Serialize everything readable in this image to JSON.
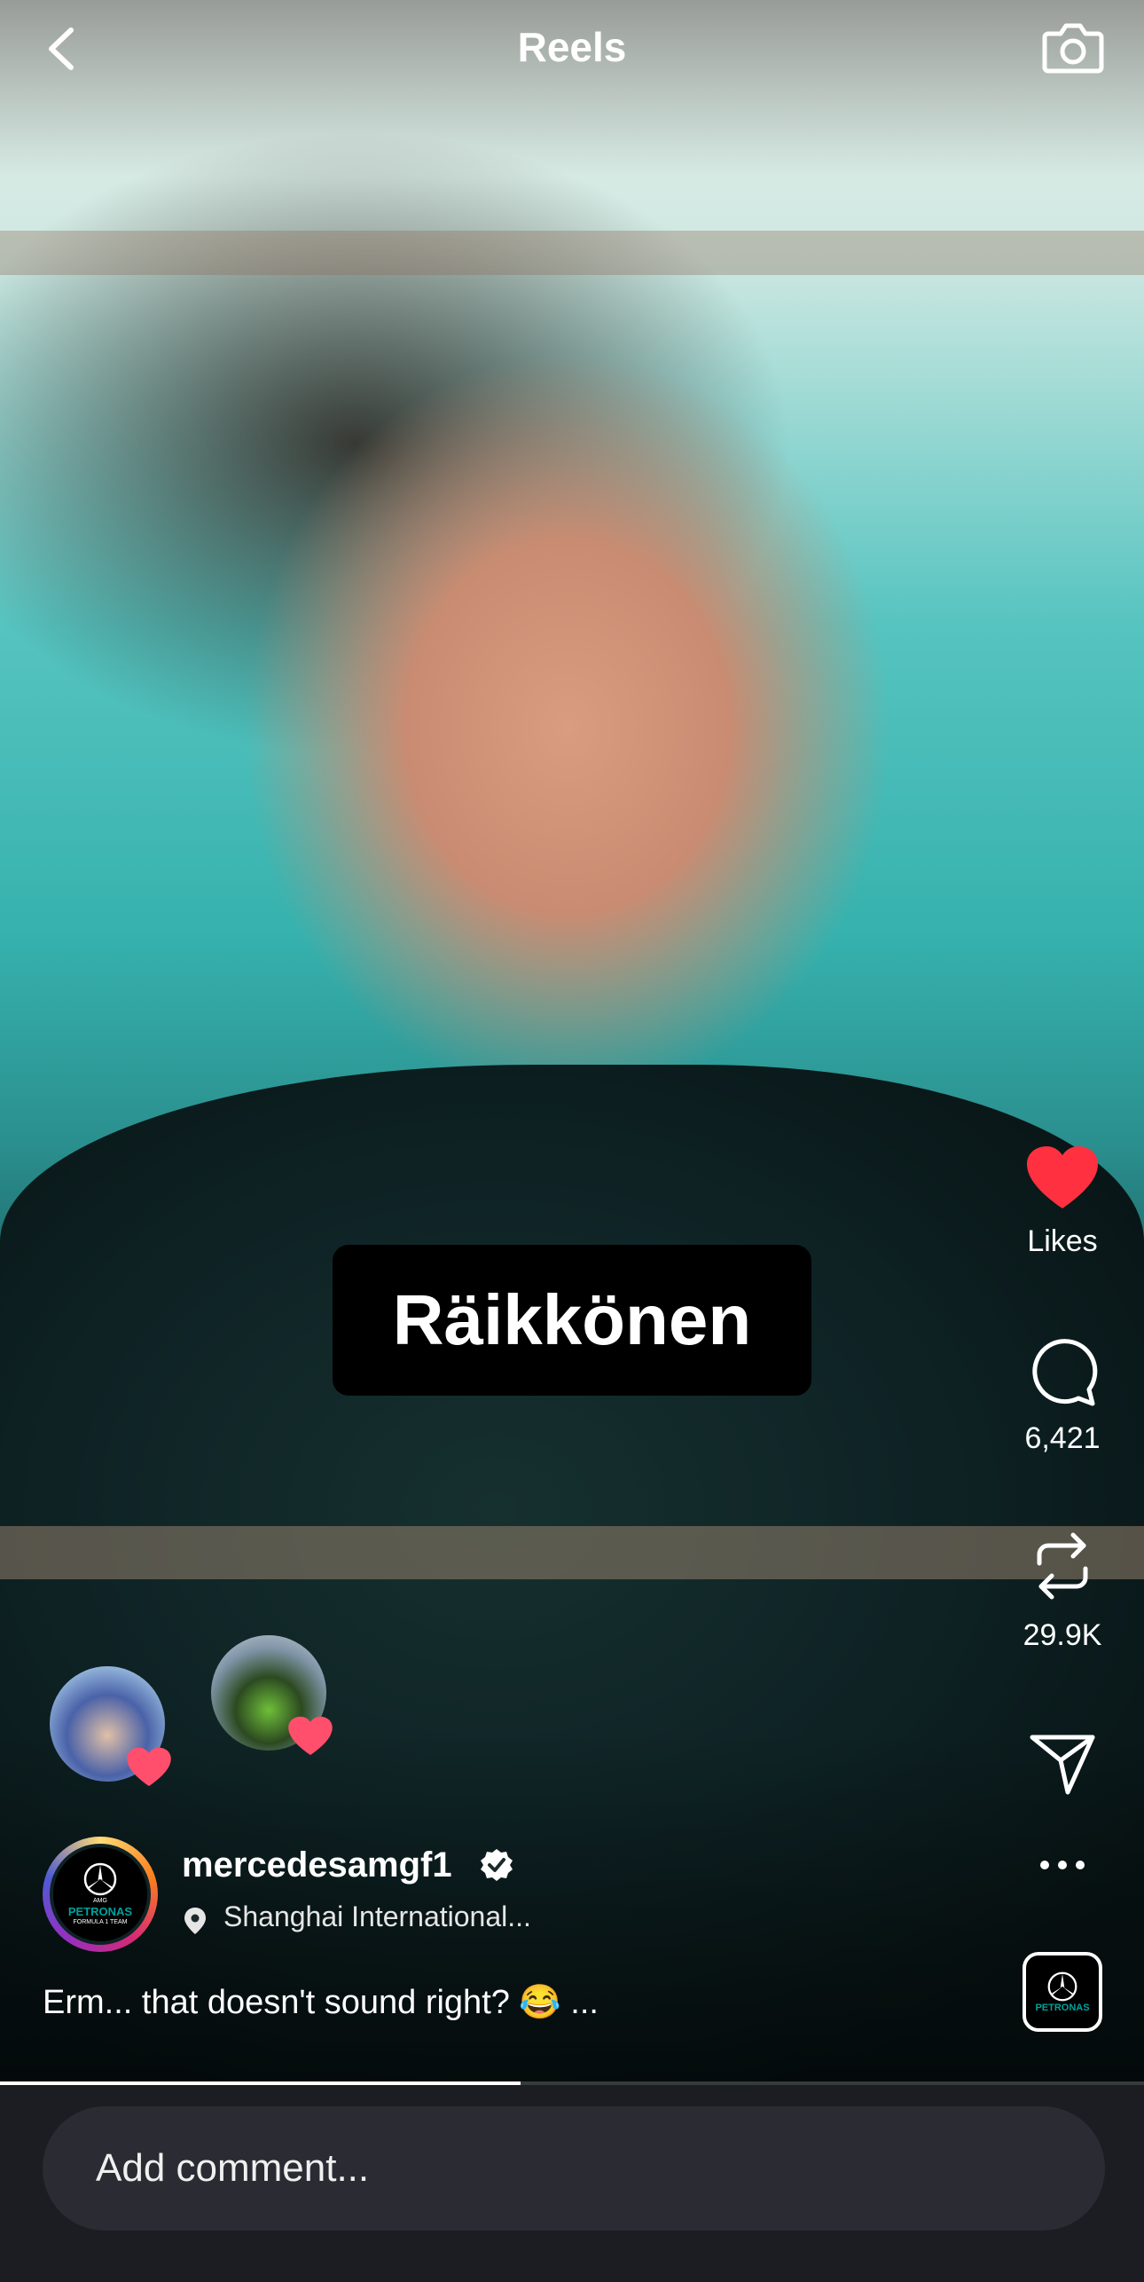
{
  "header": {
    "title": "Reels"
  },
  "video": {
    "caption_overlay": "Räikkönen",
    "progress_fraction": 0.455
  },
  "actions": {
    "likes_label": "Likes",
    "comments_count": "6,421",
    "reposts_count": "29.9K"
  },
  "post": {
    "username": "mercedesamgf1",
    "location": "Shanghai International...",
    "caption": "Erm... that doesn't sound right? 😂 ...",
    "avatar_brand_top": "AMG",
    "avatar_brand_mid": "PETRONAS",
    "avatar_brand_bottom": "FORMULA 1 TEAM"
  },
  "comment": {
    "placeholder": "Add comment..."
  },
  "colors": {
    "like_red": "#ff3040",
    "accent_teal": "#00a19c"
  },
  "icons": [
    "back-chevron-icon",
    "camera-icon",
    "heart-icon",
    "comment-icon",
    "repost-icon",
    "share-icon",
    "more-icon",
    "verified-icon",
    "location-pin-icon"
  ]
}
